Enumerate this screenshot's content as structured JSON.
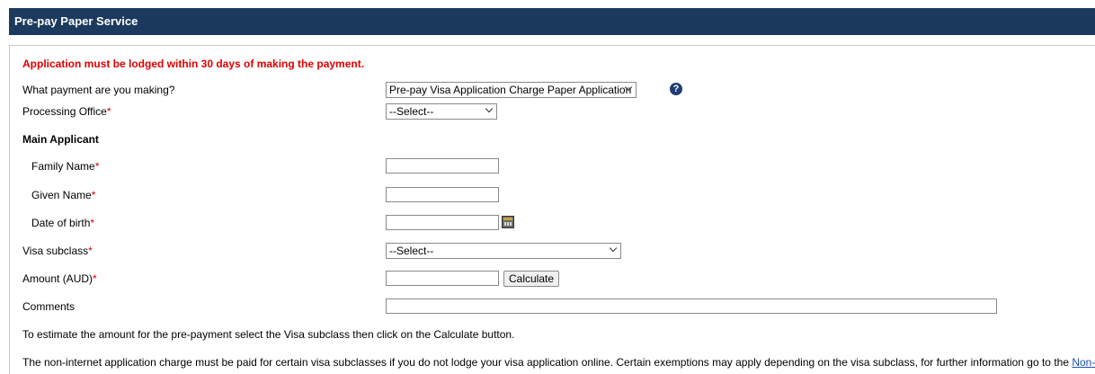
{
  "header": {
    "title": "Pre-pay Paper Service"
  },
  "form": {
    "warning": "Application must be lodged within 30 days of making the payment.",
    "payment_type": {
      "label": "What payment are you making?",
      "value": "Pre-pay Visa Application Charge Paper Application",
      "help_icon": "question-circle-icon"
    },
    "processing_office": {
      "label": "Processing Office",
      "required": "*",
      "value": "--Select--"
    },
    "main_applicant": {
      "heading": "Main Applicant"
    },
    "family_name": {
      "label": "Family Name",
      "required": "*",
      "value": ""
    },
    "given_name": {
      "label": "Given Name",
      "required": "*",
      "value": ""
    },
    "date_of_birth": {
      "label": "Date of birth",
      "required": "*",
      "value": "",
      "icon": "calendar-icon"
    },
    "visa_subclass": {
      "label": "Visa subclass",
      "required": "*",
      "value": "--Select--"
    },
    "amount": {
      "label": "Amount (AUD)",
      "required": "*",
      "value": "",
      "button": "Calculate"
    },
    "comments": {
      "label": "Comments",
      "value": ""
    },
    "estimate_note": "To estimate the amount for the pre-payment select the Visa subclass then click on the Calculate button.",
    "charge_note": "The non-internet application charge must be paid for certain visa subclasses if you do not lodge your visa application online. Certain exemptions may apply depending on the visa subclass, for further information go to the",
    "charge_link": "Non-intern"
  },
  "colors": {
    "header_bg": "#1c3a5e",
    "warning": "#e00000",
    "required": "#d00000"
  }
}
